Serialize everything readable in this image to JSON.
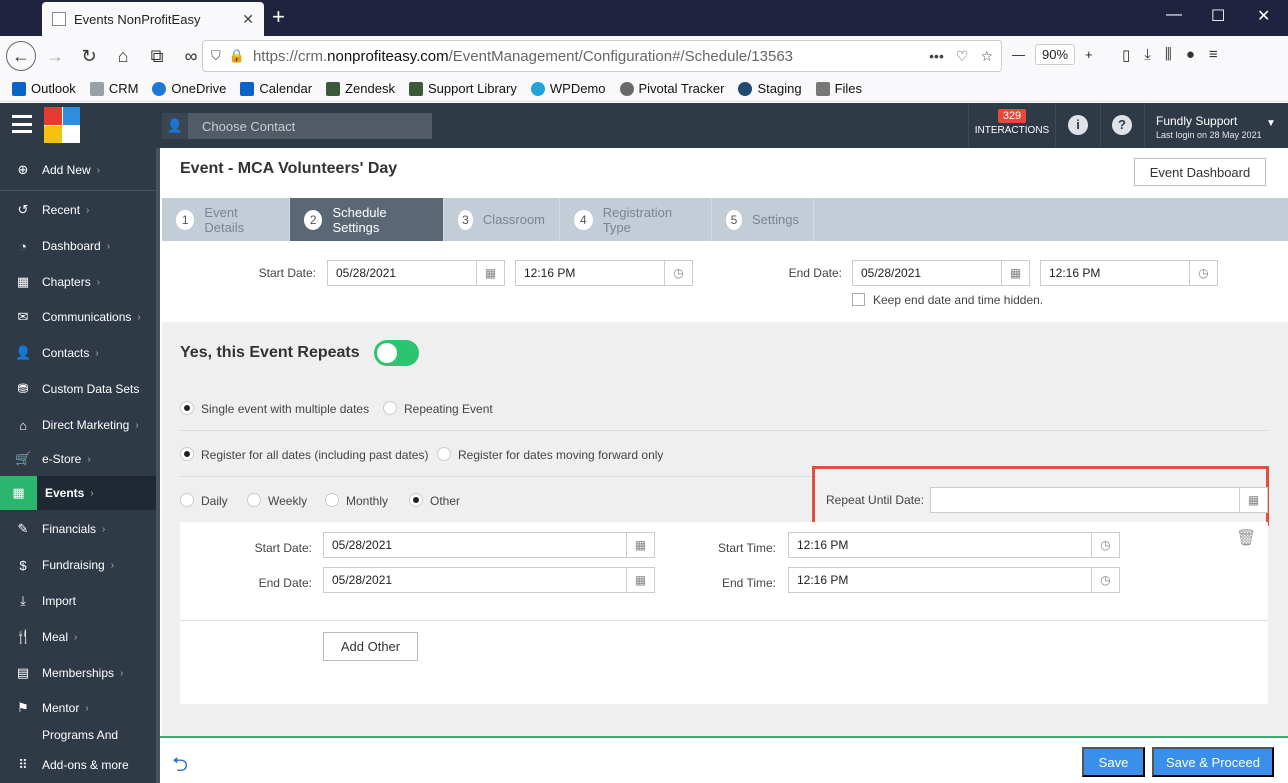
{
  "browser": {
    "tab_title": "Events NonProfitEasy",
    "url_prefix": "https://crm.",
    "url_domain": "nonprofiteasy.com",
    "url_path": "/EventManagement/Configuration#/Schedule/13563",
    "zoom": "90%"
  },
  "bookmarks": [
    {
      "label": "Outlook",
      "color": "#0a64c8"
    },
    {
      "label": "CRM",
      "color": "#9aa0a8"
    },
    {
      "label": "OneDrive",
      "color": "#1e78d6"
    },
    {
      "label": "Calendar",
      "color": "#0a64c8"
    },
    {
      "label": "Zendesk",
      "color": "#3a5a3a"
    },
    {
      "label": "Support Library",
      "color": "#3a5a3a"
    },
    {
      "label": "WPDemo",
      "color": "#22a4d8"
    },
    {
      "label": "Pivotal Tracker",
      "color": "#6a6a6a"
    },
    {
      "label": "Staging",
      "color": "#204a70"
    },
    {
      "label": "Files",
      "color": "#777777"
    }
  ],
  "header": {
    "contact_placeholder": "Choose Contact",
    "interactions_count": "329",
    "interactions_label": "INTERACTIONS",
    "user_name": "Fundly Support",
    "last_login": "Last login on 28 May 2021"
  },
  "sidebar": {
    "items": [
      {
        "label": "Add New",
        "icon": "+"
      },
      {
        "label": "Recent",
        "icon": "↺"
      },
      {
        "label": "Dashboard",
        "icon": "◔"
      },
      {
        "label": "Chapters",
        "icon": "▦"
      },
      {
        "label": "Communications",
        "icon": "✉"
      },
      {
        "label": "Contacts",
        "icon": "👤"
      },
      {
        "label": "Custom Data Sets",
        "icon": "⛃"
      },
      {
        "label": "Direct Marketing",
        "icon": "⌂"
      },
      {
        "label": "e-Store",
        "icon": "🛒"
      },
      {
        "label": "Events",
        "icon": "▦"
      },
      {
        "label": "Financials",
        "icon": "✎"
      },
      {
        "label": "Fundraising",
        "icon": "$"
      },
      {
        "label": "Import",
        "icon": "⤓"
      },
      {
        "label": "Meal",
        "icon": "🍴"
      },
      {
        "label": "Memberships",
        "icon": "▤"
      },
      {
        "label": "Mentor",
        "icon": "⚑"
      },
      {
        "label": "Programs And",
        "icon": ""
      },
      {
        "label": "Add-ons & more",
        "icon": "⋮⋮"
      }
    ]
  },
  "main": {
    "title": "Event - MCA Volunteers' Day",
    "dashboard_button": "Event Dashboard",
    "tabs": [
      {
        "num": "1",
        "label": "Event Details"
      },
      {
        "num": "2",
        "label": "Schedule Settings"
      },
      {
        "num": "3",
        "label": "Classroom"
      },
      {
        "num": "4",
        "label": "Registration Type"
      },
      {
        "num": "5",
        "label": "Settings"
      }
    ],
    "start_date_label": "Start Date:",
    "start_date": "05/28/2021",
    "start_time": "12:16 PM",
    "end_date_label": "End Date:",
    "end_date": "05/28/2021",
    "end_time": "12:16 PM",
    "keep_hidden_label": "Keep end date and time hidden.",
    "repeats_title": "Yes, this Event Repeats",
    "single_event_label": "Single event with multiple dates",
    "repeating_event_label": "Repeating Event",
    "register_all_label": "Register for all dates (including past dates)",
    "register_forward_label": "Register for dates moving forward only",
    "freq": [
      "Daily",
      "Weekly",
      "Monthly",
      "Other"
    ],
    "repeat_until_label": "Repeat Until Date:",
    "repeat_until_value": "",
    "other_start_date_label": "Start Date:",
    "other_start_date": "05/28/2021",
    "other_start_time_label": "Start Time:",
    "other_start_time": "12:16 PM",
    "other_end_date_label": "End Date:",
    "other_end_date": "05/28/2021",
    "other_end_time_label": "End Time:",
    "other_end_time": "12:16 PM",
    "add_other_button": "Add Other"
  },
  "footer": {
    "save_button": "Save",
    "save_proceed_button": "Save & Proceed"
  },
  "colors": {
    "accent_green": "#2cb56f",
    "primary_blue": "#3a8fea",
    "highlight_red": "#e0503c",
    "sidebar_bg": "#2f3a47"
  }
}
